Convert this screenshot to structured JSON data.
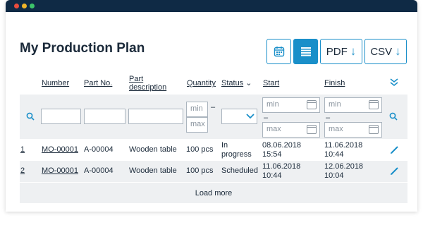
{
  "window": {
    "controls": [
      "close",
      "minimize",
      "maximize"
    ]
  },
  "page": {
    "title": "My Production Plan"
  },
  "toolbar": {
    "calendar_view_icon": "calendar-icon",
    "list_view_icon": "list-icon",
    "pdf_label": "PDF",
    "csv_label": "CSV",
    "download_arrow": "↓"
  },
  "columns": {
    "number": "Number",
    "part_no": "Part No.",
    "part_desc_1": "Part",
    "part_desc_2": "description",
    "quantity": "Quantity",
    "status": "Status",
    "status_sort": "⌄",
    "start": "Start",
    "finish": "Finish"
  },
  "filters": {
    "qty_min": "min",
    "qty_max": "max",
    "start_min": "min",
    "start_max": "max",
    "finish_min": "min",
    "finish_max": "max",
    "range_sep": "–"
  },
  "rows": [
    {
      "index": "1",
      "number": "MO-00001",
      "part_no": "A-00004",
      "part_desc": "Wooden table",
      "quantity": "100 pcs",
      "status_1": "In",
      "status_2": "progress",
      "start_1": "08.06.2018",
      "start_2": "15:54",
      "finish_1": "11.06.2018",
      "finish_2": "10:44"
    },
    {
      "index": "2",
      "number": "MO-00001",
      "part_no": "A-00004",
      "part_desc": "Wooden table",
      "quantity": "100 pcs",
      "status_1": "Scheduled",
      "status_2": "",
      "start_1": "11.06.2018",
      "start_2": "10:44",
      "finish_1": "12.06.2018",
      "finish_2": "10:04"
    }
  ],
  "load_more": "Load more",
  "colors": {
    "accent": "#1a8fc9",
    "titlebar": "#0f2a45",
    "band": "#eef0f2"
  }
}
